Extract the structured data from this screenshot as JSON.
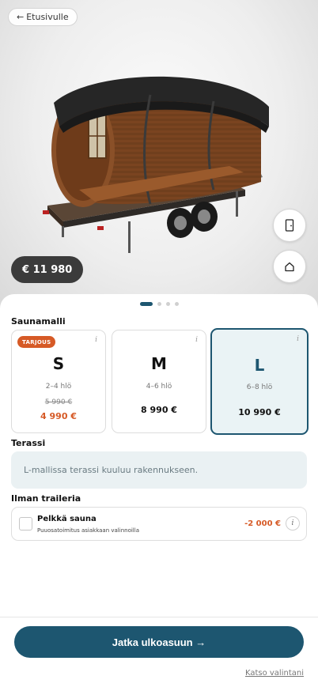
{
  "hero": {
    "back_label": "Etusivulle",
    "price": "€ 11 980",
    "icons": {
      "back": "arrow-left-icon",
      "door": "door-icon",
      "home": "home-icon"
    }
  },
  "carousel": {
    "pages": 4,
    "active": 0
  },
  "model_section": {
    "label": "Saunamalli",
    "cards": [
      {
        "letter": "S",
        "people": "2–4 hlö",
        "badge": "TARJOUS",
        "old_price": "5 990 €",
        "price": "4 990 €",
        "info": "i",
        "selected": false
      },
      {
        "letter": "M",
        "people": "4–6 hlö",
        "price": "8 990 €",
        "info": "i",
        "selected": false
      },
      {
        "letter": "L",
        "people": "6–8 hlö",
        "price": "10 990 €",
        "info": "i",
        "selected": true
      }
    ]
  },
  "terrace": {
    "label": "Terassi",
    "note": "L-mallissa terassi kuuluu rakennukseen."
  },
  "trailer": {
    "label": "Ilman traileria",
    "option": {
      "title": "Pelkkä sauna",
      "subtitle": "Puuosatoimitus asiakkaan valinnoilla",
      "price": "-2 000 €",
      "info": "i",
      "checked": false
    }
  },
  "footer": {
    "cta_label": "Jatka ulkoasuun →",
    "review_link": "Katso valintani"
  },
  "colors": {
    "primary": "#1d5670",
    "accent": "#d65a26",
    "selected_bg": "#eaf3f5"
  }
}
